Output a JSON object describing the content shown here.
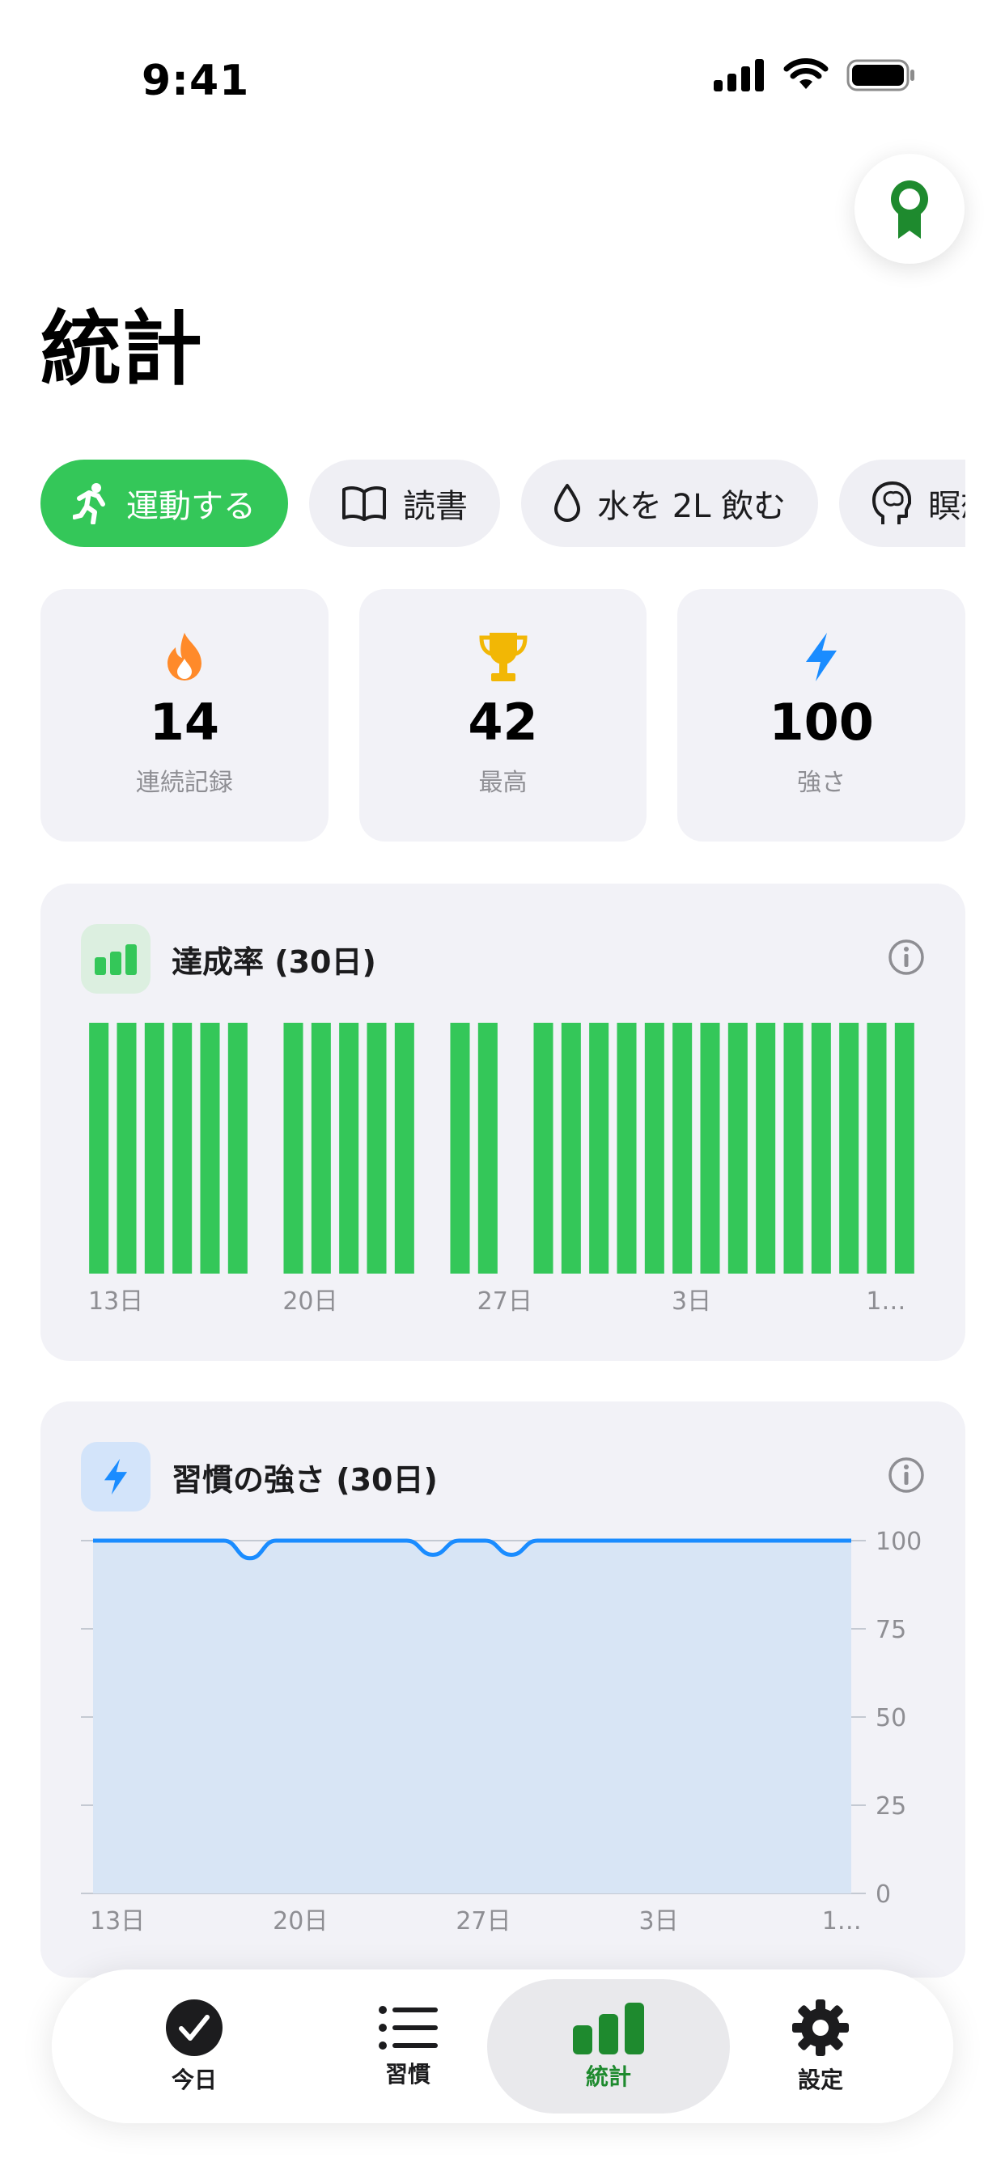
{
  "status_bar": {
    "time": "9:41"
  },
  "page": {
    "title": "統計"
  },
  "habits": [
    {
      "label": "運動する",
      "icon": "running-icon",
      "active": true
    },
    {
      "label": "読書",
      "icon": "book-icon",
      "active": false
    },
    {
      "label": "水を 2L 飲む",
      "icon": "drop-icon",
      "active": false
    },
    {
      "label": "瞑想",
      "icon": "brain-icon",
      "active": false
    }
  ],
  "stats": [
    {
      "value": "14",
      "label": "連続記録",
      "icon": "flame-icon"
    },
    {
      "value": "42",
      "label": "最高",
      "icon": "trophy-icon"
    },
    {
      "value": "100",
      "label": "強さ",
      "icon": "bolt-icon"
    }
  ],
  "colors": {
    "accent_green": "#34c759",
    "bar_green": "#34c759",
    "strength_blue": "#1a8cff",
    "strength_fill": "#d8e5f5",
    "tab_active": "#1e8a2e"
  },
  "completion_card": {
    "title": "達成率 (30日)",
    "chart_data": {
      "type": "bar",
      "values": [
        1,
        1,
        1,
        1,
        1,
        1,
        0,
        1,
        1,
        1,
        1,
        1,
        0,
        1,
        1,
        0,
        1,
        1,
        1,
        1,
        1,
        1,
        1,
        1,
        1,
        1,
        1,
        1,
        1,
        1
      ],
      "tick_labels": [
        {
          "index": 0,
          "label": "13日"
        },
        {
          "index": 7,
          "label": "20日"
        },
        {
          "index": 14,
          "label": "27日"
        },
        {
          "index": 21,
          "label": "3日"
        },
        {
          "index": 28,
          "label": "1…"
        }
      ],
      "ylim": [
        0,
        1
      ],
      "grid": false
    }
  },
  "strength_card": {
    "title": "習慣の強さ (30日)",
    "chart_data": {
      "type": "area",
      "values": [
        100,
        100,
        100,
        100,
        100,
        100,
        95,
        100,
        100,
        100,
        100,
        100,
        100,
        96,
        100,
        100,
        96,
        100,
        100,
        100,
        100,
        100,
        100,
        100,
        100,
        100,
        100,
        100,
        100,
        100
      ],
      "ylim": [
        0,
        100
      ],
      "y_ticks": [
        "100",
        "75",
        "50",
        "25",
        "0"
      ],
      "tick_labels": [
        {
          "index": 0,
          "label": "13日"
        },
        {
          "index": 7,
          "label": "20日"
        },
        {
          "index": 14,
          "label": "27日"
        },
        {
          "index": 21,
          "label": "3日"
        },
        {
          "index": 28,
          "label": "1…"
        }
      ],
      "grid": true
    }
  },
  "tabs": [
    {
      "label": "今日",
      "icon": "check-circle-icon",
      "active": false
    },
    {
      "label": "習慣",
      "icon": "list-icon",
      "active": false
    },
    {
      "label": "統計",
      "icon": "bar-chart-icon",
      "active": true
    },
    {
      "label": "設定",
      "icon": "gear-icon",
      "active": false
    }
  ]
}
